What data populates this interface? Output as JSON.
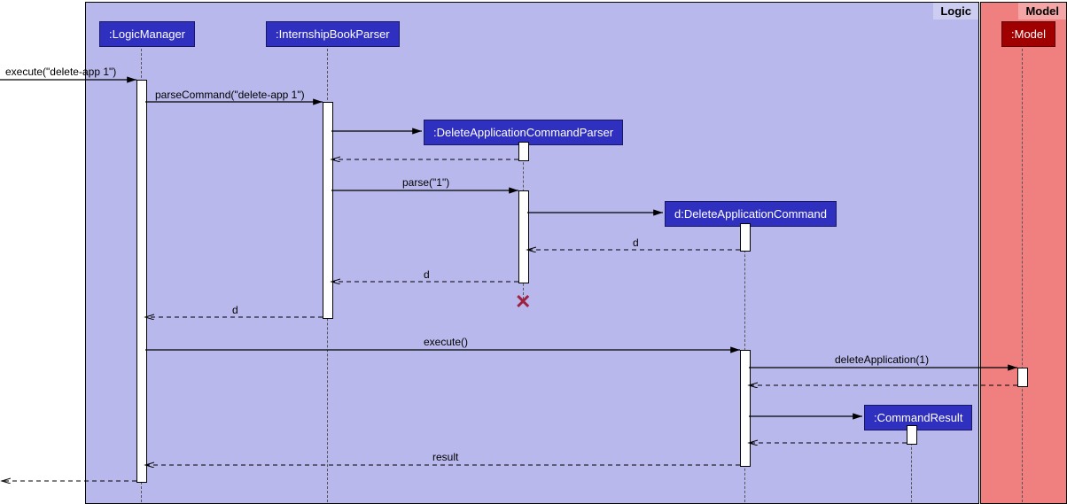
{
  "frames": {
    "logic": "Logic",
    "model": "Model"
  },
  "participants": {
    "logicManager": ":LogicManager",
    "ibParser": ":InternshipBookParser",
    "dacParser": ":DeleteApplicationCommandParser",
    "dac": "d:DeleteApplicationCommand",
    "commandResult": ":CommandResult",
    "model": ":Model"
  },
  "messages": {
    "execute1": "execute(\"delete-app 1\")",
    "parseCommand": "parseCommand(\"delete-app 1\")",
    "parse1": "parse(\"1\")",
    "d1": "d",
    "d2": "d",
    "d3": "d",
    "execute2": "execute()",
    "deleteApp": "deleteApplication(1)",
    "result": "result"
  },
  "chart_data": {
    "type": "sequence_diagram",
    "frames": [
      {
        "name": "Logic",
        "contains": [
          "LogicManager",
          "InternshipBookParser",
          "DeleteApplicationCommandParser",
          "DeleteApplicationCommand",
          "CommandResult"
        ]
      },
      {
        "name": "Model",
        "contains": [
          "Model"
        ]
      }
    ],
    "participants": [
      {
        "id": "LogicManager",
        "label": ":LogicManager",
        "preexisting": true
      },
      {
        "id": "InternshipBookParser",
        "label": ":InternshipBookParser",
        "preexisting": true
      },
      {
        "id": "DeleteApplicationCommandParser",
        "label": ":DeleteApplicationCommandParser",
        "preexisting": false,
        "destroyed": true
      },
      {
        "id": "DeleteApplicationCommand",
        "label": "d:DeleteApplicationCommand",
        "preexisting": false
      },
      {
        "id": "CommandResult",
        "label": ":CommandResult",
        "preexisting": false
      },
      {
        "id": "Model",
        "label": ":Model",
        "preexisting": true
      }
    ],
    "messages": [
      {
        "from": "[",
        "to": "LogicManager",
        "label": "execute(\"delete-app 1\")",
        "type": "call"
      },
      {
        "from": "LogicManager",
        "to": "InternshipBookParser",
        "label": "parseCommand(\"delete-app 1\")",
        "type": "call"
      },
      {
        "from": "InternshipBookParser",
        "to": "DeleteApplicationCommandParser",
        "label": "",
        "type": "create"
      },
      {
        "from": "DeleteApplicationCommandParser",
        "to": "InternshipBookParser",
        "label": "",
        "type": "return"
      },
      {
        "from": "InternshipBookParser",
        "to": "DeleteApplicationCommandParser",
        "label": "parse(\"1\")",
        "type": "call"
      },
      {
        "from": "DeleteApplicationCommandParser",
        "to": "DeleteApplicationCommand",
        "label": "",
        "type": "create"
      },
      {
        "from": "DeleteApplicationCommand",
        "to": "DeleteApplicationCommandParser",
        "label": "d",
        "type": "return"
      },
      {
        "from": "DeleteApplicationCommandParser",
        "to": "InternshipBookParser",
        "label": "d",
        "type": "return"
      },
      {
        "from": "DeleteApplicationCommandParser",
        "to": "",
        "label": "",
        "type": "destroy"
      },
      {
        "from": "InternshipBookParser",
        "to": "LogicManager",
        "label": "d",
        "type": "return"
      },
      {
        "from": "LogicManager",
        "to": "DeleteApplicationCommand",
        "label": "execute()",
        "type": "call"
      },
      {
        "from": "DeleteApplicationCommand",
        "to": "Model",
        "label": "deleteApplication(1)",
        "type": "call"
      },
      {
        "from": "Model",
        "to": "DeleteApplicationCommand",
        "label": "",
        "type": "return"
      },
      {
        "from": "DeleteApplicationCommand",
        "to": "CommandResult",
        "label": "",
        "type": "create"
      },
      {
        "from": "CommandResult",
        "to": "DeleteApplicationCommand",
        "label": "",
        "type": "return"
      },
      {
        "from": "DeleteApplicationCommand",
        "to": "LogicManager",
        "label": "result",
        "type": "return"
      },
      {
        "from": "LogicManager",
        "to": "[",
        "label": "",
        "type": "return"
      }
    ]
  }
}
